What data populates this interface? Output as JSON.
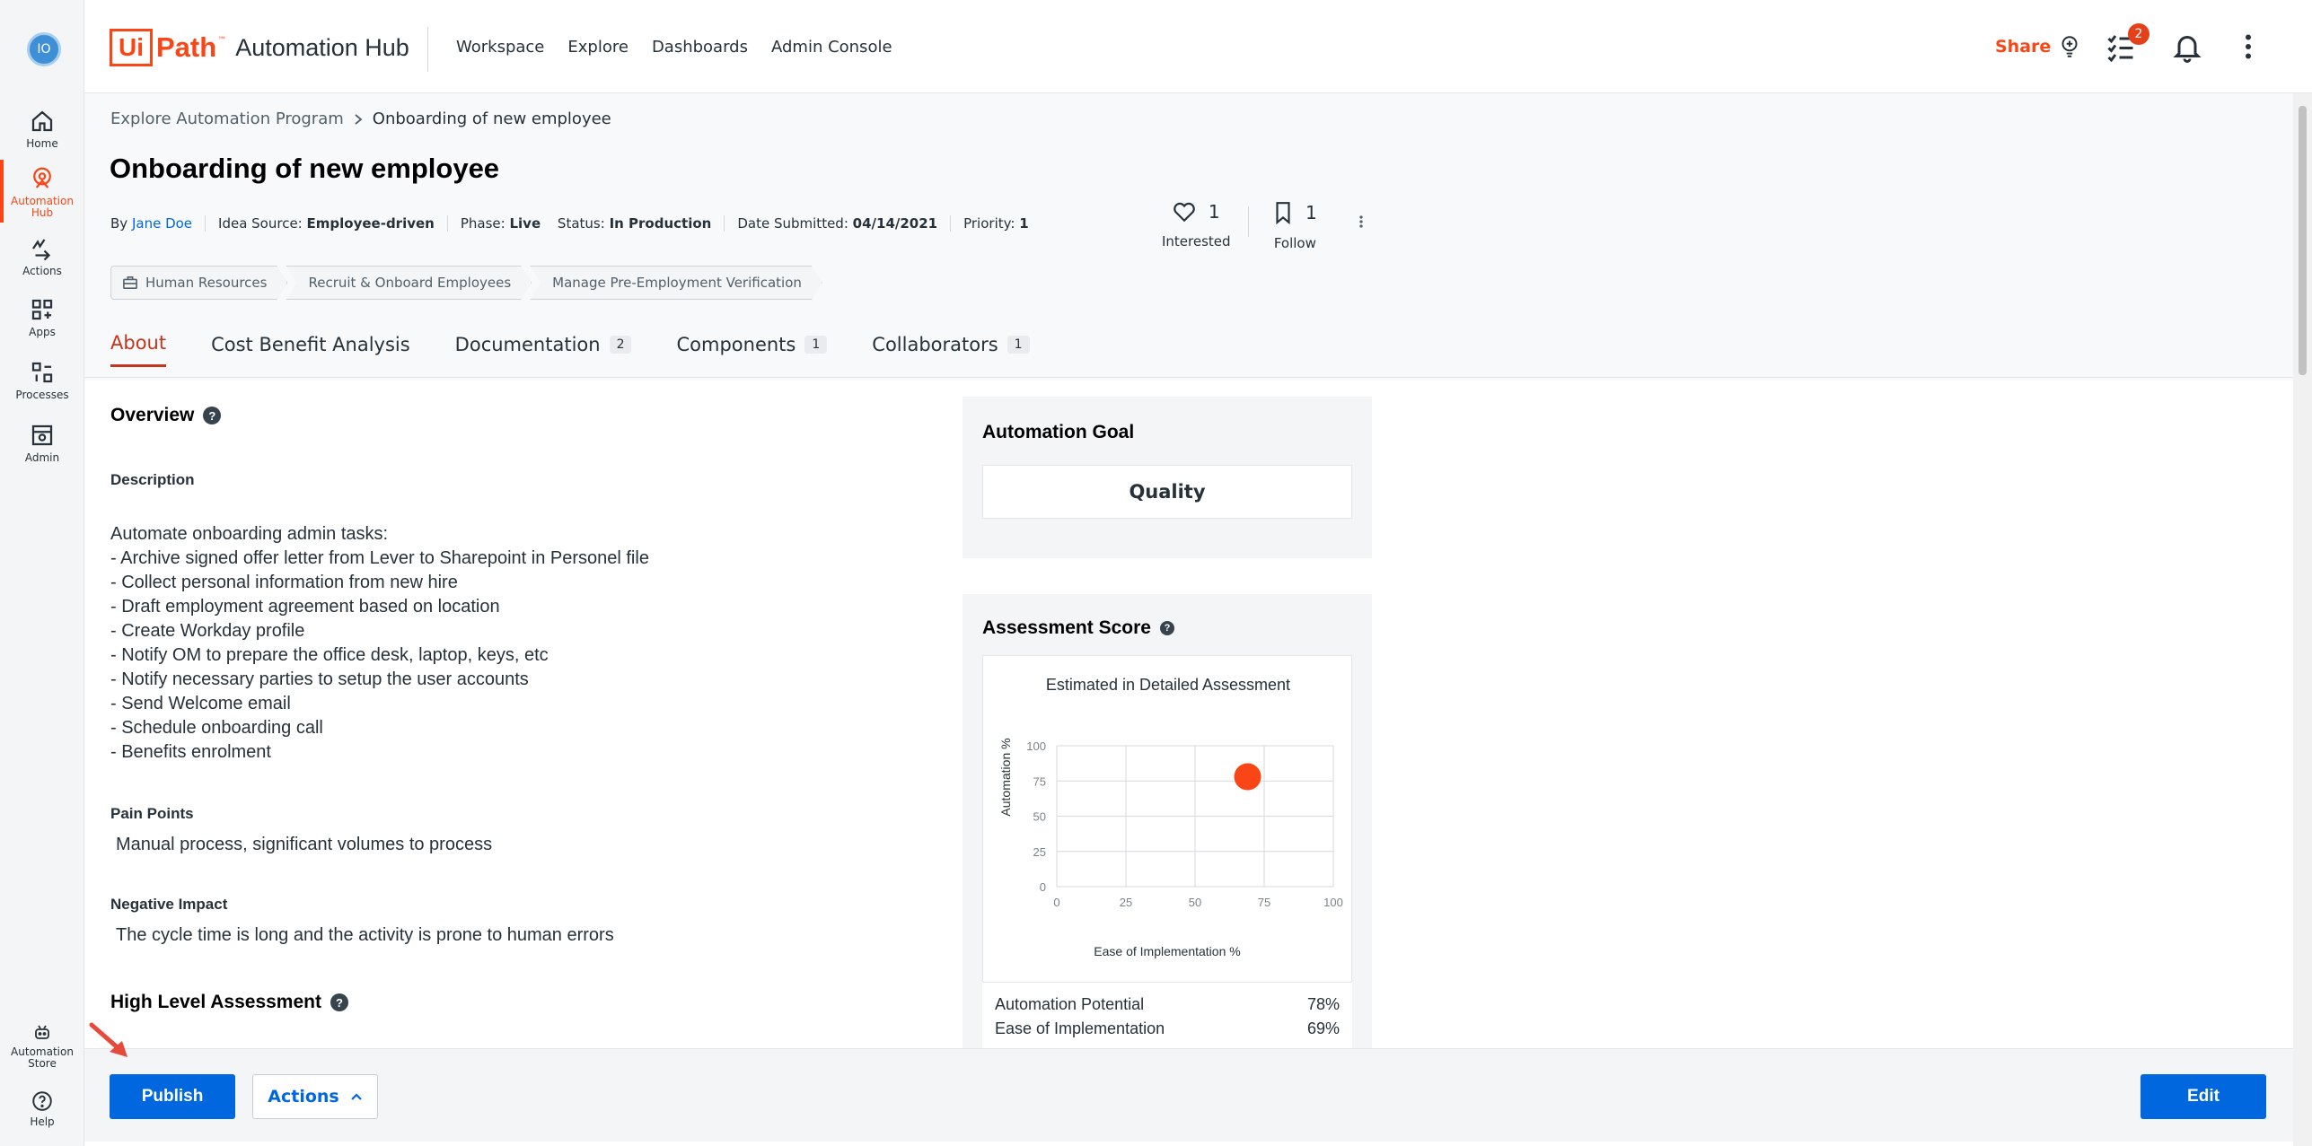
{
  "user": {
    "initials": "IO"
  },
  "rail": {
    "items": [
      {
        "label": "Home"
      },
      {
        "label": "Automation Hub"
      },
      {
        "label": "Actions"
      },
      {
        "label": "Apps"
      },
      {
        "label": "Processes"
      },
      {
        "label": "Admin"
      },
      {
        "label": "Automation Store"
      },
      {
        "label": "Help"
      }
    ]
  },
  "topbar": {
    "logo_ui": "Ui",
    "logo_path": "Path",
    "logo_tm": "™",
    "product": "Automation Hub",
    "nav": [
      "Workspace",
      "Explore",
      "Dashboards",
      "Admin Console"
    ],
    "share": "Share",
    "tasks_badge": "2"
  },
  "breadcrumb": {
    "parent": "Explore Automation Program",
    "current": "Onboarding of new employee"
  },
  "idea": {
    "title": "Onboarding of new employee",
    "by_label": "By",
    "author": "Jane Doe",
    "source_label": "Idea Source:",
    "source": "Employee-driven",
    "phase_label": "Phase:",
    "phase": "Live",
    "status_label": "Status:",
    "status": "In Production",
    "date_label": "Date Submitted:",
    "date": "04/14/2021",
    "priority_label": "Priority:",
    "priority": "1"
  },
  "reactions": {
    "interested_count": "1",
    "interested_label": "Interested",
    "follow_count": "1",
    "follow_label": "Follow"
  },
  "tags": [
    "Human Resources",
    "Recruit & Onboard Employees",
    "Manage Pre-Employment Verification"
  ],
  "tabs": [
    {
      "label": "About",
      "count": ""
    },
    {
      "label": "Cost Benefit Analysis",
      "count": ""
    },
    {
      "label": "Documentation",
      "count": "2"
    },
    {
      "label": "Components",
      "count": "1"
    },
    {
      "label": "Collaborators",
      "count": "1"
    }
  ],
  "overview": {
    "title": "Overview",
    "description_label": "Description",
    "description": "Automate onboarding admin tasks:\n- Archive signed offer letter from Lever to Sharepoint in Personel file\n- Collect personal information from new hire\n- Draft employment agreement based on location\n- Create Workday profile\n- Notify OM to prepare the office desk, laptop, keys, etc\n- Notify necessary parties to setup the user accounts\n- Send Welcome email\n- Schedule onboarding call\n- Benefits enrolment",
    "pain_label": "Pain Points",
    "pain": "Manual process, significant volumes to process",
    "impact_label": "Negative Impact",
    "impact": "The cycle time is long and the activity is prone to human errors",
    "assessment_title": "High Level Assessment"
  },
  "goal": {
    "title": "Automation Goal",
    "value": "Quality"
  },
  "assessment": {
    "title": "Assessment Score",
    "chart_title": "Estimated in Detailed Assessment",
    "potential_label": "Automation Potential",
    "potential": "78%",
    "ease_label": "Ease of Implementation",
    "ease": "69%"
  },
  "chart_data": {
    "type": "scatter",
    "title": "Estimated in Detailed Assessment",
    "xlabel": "Ease of Implementation %",
    "ylabel": "Automation %",
    "xlim": [
      0,
      100
    ],
    "ylim": [
      0,
      100
    ],
    "xticks": [
      "0",
      "25",
      "50",
      "75",
      "100"
    ],
    "yticks": [
      "0",
      "25",
      "50",
      "75",
      "100"
    ],
    "grid": true,
    "points": [
      {
        "x": 69,
        "y": 78
      }
    ],
    "color": "#fa4616"
  },
  "footer": {
    "publish": "Publish",
    "actions": "Actions",
    "edit": "Edit"
  },
  "colors": {
    "accent": "#fa4616",
    "primary": "#0067df"
  }
}
